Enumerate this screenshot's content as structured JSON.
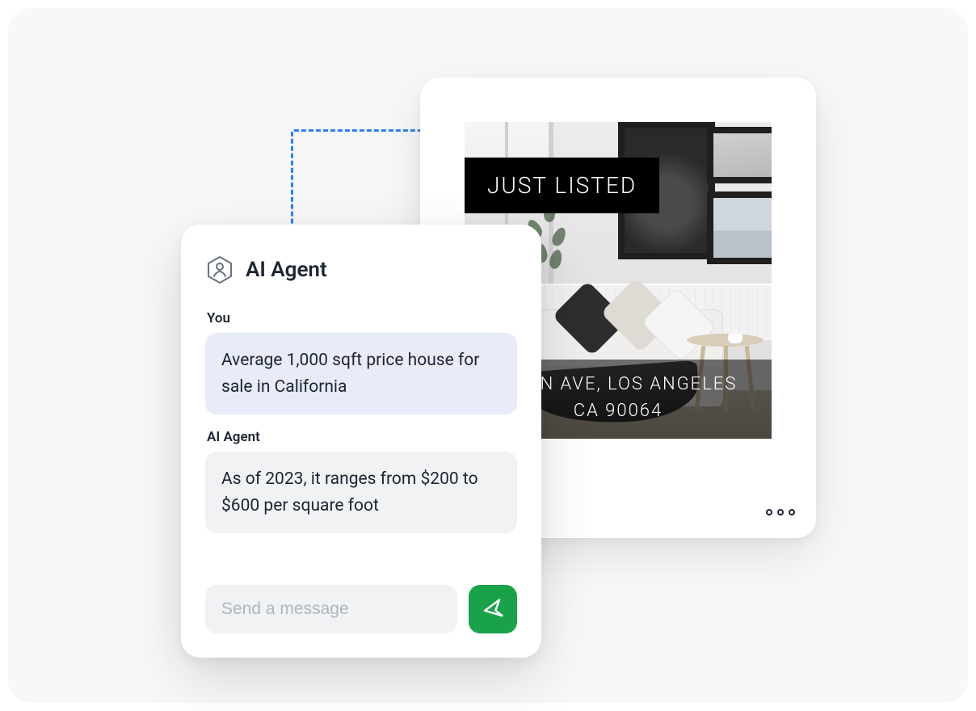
{
  "listing": {
    "badge": "JUST LISTED",
    "address_line1": "NDON AVE, LOS ANGELES",
    "address_line2": "CA 90064",
    "more_icon": "more-options-icon"
  },
  "chat": {
    "title": "AI Agent",
    "user_label": "You",
    "user_message": "Average 1,000 sqft price house for sale in California",
    "agent_label": "AI Agent",
    "agent_message": "As of 2023, it ranges from $200 to $600 per square foot",
    "composer_placeholder": "Send a message"
  }
}
